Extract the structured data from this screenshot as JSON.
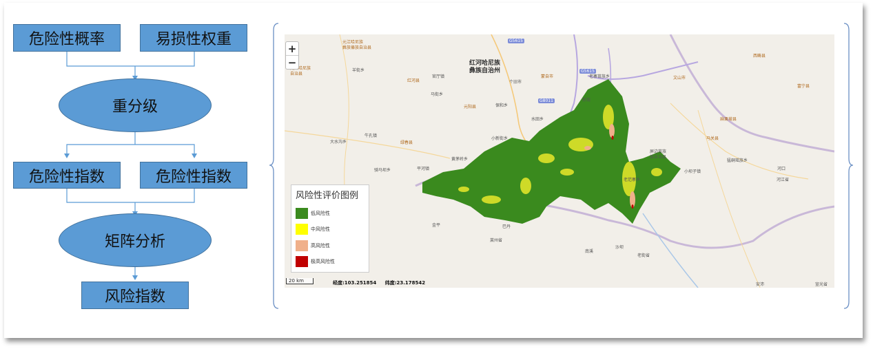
{
  "flowchart": {
    "box_prob": "危险性概率",
    "box_weight": "易损性权重",
    "ellipse_reclass": "重分级",
    "box_index_left": "危险性指数",
    "box_index_right": "危险性指数",
    "ellipse_matrix": "矩阵分析",
    "box_risk": "风险指数"
  },
  "map": {
    "zoom_in": "+",
    "zoom_out": "−",
    "legend": {
      "title": "风险性评价图例",
      "items": [
        {
          "label": "低风险性",
          "color": "#3a8a1e"
        },
        {
          "label": "中风险性",
          "color": "#ffff00"
        },
        {
          "label": "高风险性",
          "color": "#f0b08a"
        },
        {
          "label": "极高风险性",
          "color": "#c00000"
        }
      ]
    },
    "scale": "20 km",
    "longitude": "经度:103.251854",
    "latitude": "纬度:23.178542",
    "region_title_1": "红河哈尼族",
    "region_title_2": "彝族自治州",
    "labels": {
      "l1": "元江哈尼族",
      "l2": "彝族傣族自治县",
      "l3": "元江哈尼族",
      "l4": "自治县",
      "l5": "羊街乡",
      "l6": "红河县",
      "l7": "官厅镇",
      "l8": "个旧市",
      "l9": "蒙自市",
      "l10": "老寨苗族乡",
      "l11": "文山市",
      "l12": "西畴县",
      "l13": "绿春县",
      "l14": "元阳县",
      "l15": "屏边苗族",
      "l16": "族自治县",
      "l17": "马关县",
      "l18": "麻栗坡县",
      "l19": "河口",
      "l20": "金平",
      "l21": "巴丹",
      "l22": "黄茅岭乡",
      "l23": "小新街乡",
      "l24": "牛孔镇",
      "l25": "大水沟乡",
      "l26": "平河镇",
      "l27": "骑马坝乡",
      "l28": "老范寨乡",
      "l29": "小坝子镇",
      "l30": "猛硐瑶族乡",
      "l31": "莱州省",
      "l32": "老街省",
      "l33": "安沛",
      "l34": "宣光省",
      "l35": "沙坝",
      "l36": "保和乡",
      "l37": "马街乡",
      "l38": "水田乡",
      "l39": "新现",
      "l40": "南溪",
      "l41": "河江省",
      "l42": "富宁县",
      "s1": "G8011",
      "s2": "G5615",
      "s3": "G5615"
    }
  }
}
